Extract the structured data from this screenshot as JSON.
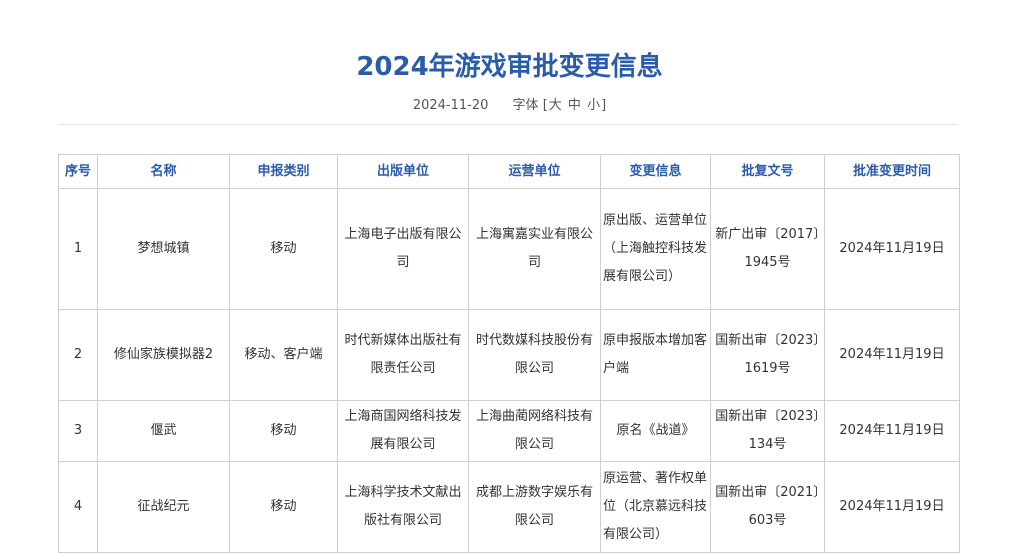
{
  "article": {
    "title": "2024年游戏审批变更信息",
    "date": "2024-11-20",
    "font_label": "字体",
    "font_open": "[",
    "font_close": "]",
    "font_sizes": [
      "大",
      "中",
      "小"
    ]
  },
  "table": {
    "headers": [
      "序号",
      "名称",
      "申报类别",
      "出版单位",
      "运营单位",
      "变更信息",
      "批复文号",
      "批准变更时间"
    ],
    "rows": [
      [
        "1",
        "梦想城镇",
        "移动",
        "上海电子出版有限公司",
        "上海寓嘉实业有限公司",
        "原出版、运营单位（上海触控科技发展有限公司）",
        "新广出审〔2017〕1945号",
        "2024年11月19日"
      ],
      [
        "2",
        "修仙家族模拟器2",
        "移动、客户端",
        "时代新媒体出版社有限责任公司",
        "时代数媒科技股份有限公司",
        "原申报版本增加客户端",
        "国新出审〔2023〕1619号",
        "2024年11月19日"
      ],
      [
        "3",
        "偃武",
        "移动",
        "上海商国网络科技发展有限公司",
        "上海曲蔺网络科技有限公司",
        "原名《战道》",
        "国新出审〔2023〕134号",
        "2024年11月19日"
      ],
      [
        "4",
        "征战纪元",
        "移动",
        "上海科学技术文献出版社有限公司",
        "成都上游数字娱乐有限公司",
        "原运营、著作权单位（北京慕远科技有限公司）",
        "国新出审〔2021〕603号",
        "2024年11月19日"
      ]
    ]
  },
  "colors": {
    "title": "#2a5caa",
    "header_text": "#2a5caa",
    "border": "#cfcfcf",
    "body_text": "#333333"
  }
}
